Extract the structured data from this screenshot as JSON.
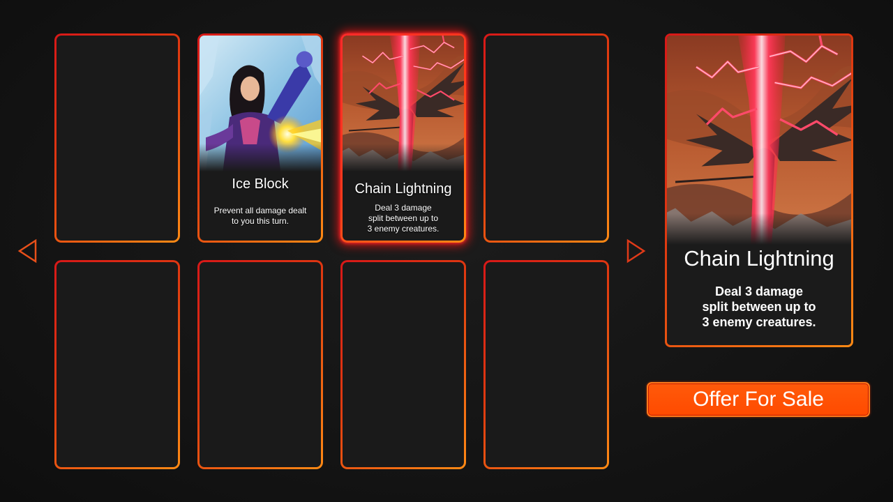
{
  "grid": {
    "cards": [
      {
        "title": "",
        "desc": ""
      },
      {
        "title": "Ice Block",
        "desc": "Prevent all damage dealt\nto you this turn.",
        "art": "ice-mage-art"
      },
      {
        "title": "Chain Lightning",
        "desc": "Deal 3 damage\nsplit between up to\n3 enemy creatures.",
        "art": "dragon-lightning-art",
        "selected": true
      },
      {
        "title": "",
        "desc": ""
      },
      {
        "title": "",
        "desc": ""
      },
      {
        "title": "",
        "desc": ""
      },
      {
        "title": "",
        "desc": ""
      },
      {
        "title": "",
        "desc": ""
      }
    ]
  },
  "nav": {
    "prev_icon": "triangle-left-icon",
    "next_icon": "triangle-right-icon"
  },
  "preview": {
    "title": "Chain Lightning",
    "desc": "Deal 3 damage\nsplit between up to\n3 enemy creatures.",
    "art": "dragon-lightning-art"
  },
  "actions": {
    "sale_label": "Offer For Sale"
  },
  "colors": {
    "border_red": "#d81818",
    "border_orange": "#ff8a14",
    "button": "#ff4a00",
    "card_bg": "#1a1a1a"
  }
}
